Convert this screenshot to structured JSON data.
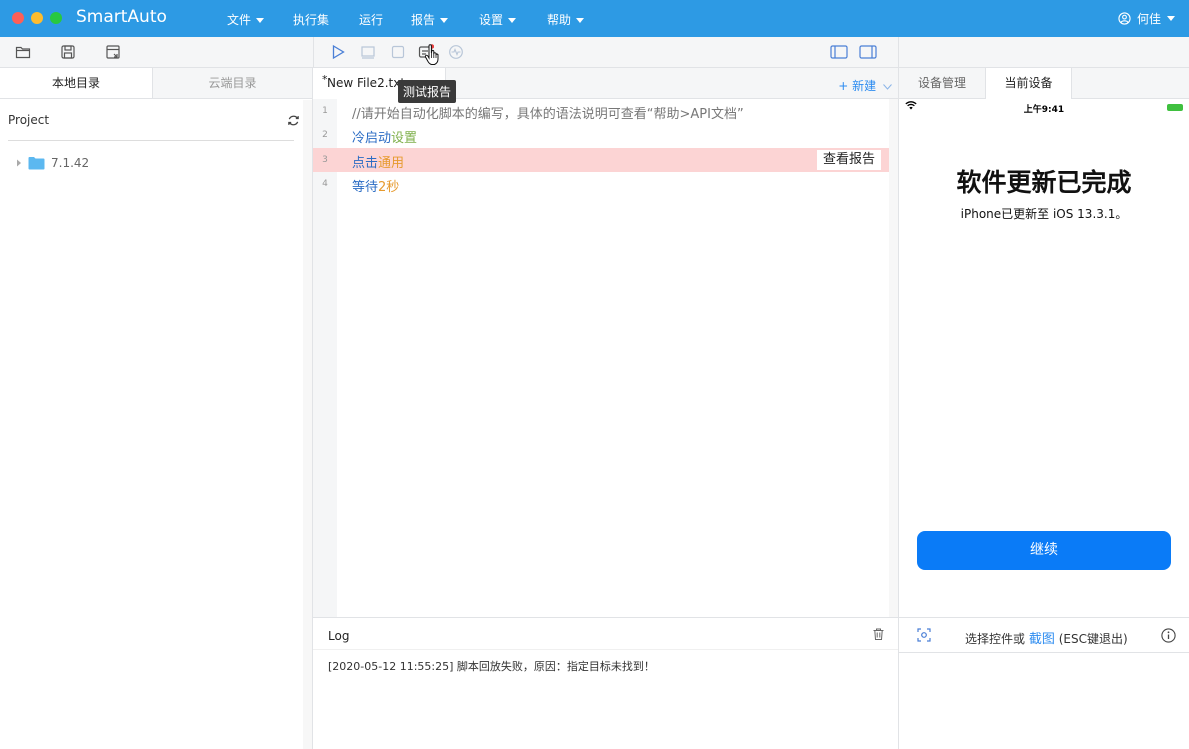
{
  "app": {
    "name": "SmartAuto"
  },
  "menu": {
    "file": "文件",
    "suite": "执行集",
    "run": "运行",
    "report": "报告",
    "settings": "设置",
    "help": "帮助"
  },
  "user": {
    "name": "何佳"
  },
  "left_panel": {
    "tabs": [
      "本地目录",
      "云端目录"
    ],
    "project_label": "Project",
    "folder": "7.1.42"
  },
  "editor": {
    "tab_title": "New File2.txt",
    "modified_marker": "*",
    "new_label": "+ 新建",
    "tooltip": "测试报告",
    "lines": [
      {
        "num": "1",
        "comment": "//请开始自动化脚本的编写，具体的语法说明可查看“帮助>API文档”"
      },
      {
        "num": "2",
        "keyword": "冷启动",
        "arg": "设置"
      },
      {
        "num": "3",
        "keyword": "点击",
        "arg": "通用",
        "action": "查看报告"
      },
      {
        "num": "4",
        "keyword": "等待",
        "arg": "2秒"
      }
    ]
  },
  "log": {
    "title": "Log",
    "entries": [
      "[2020-05-12 11:55:25] 脚本回放失败，原因：指定目标未找到！"
    ]
  },
  "right_panel": {
    "tabs": [
      "设备管理",
      "当前设备"
    ],
    "status_time": "上午9:41",
    "update_title": "软件更新已完成",
    "update_subtitle": "iPhone已更新至 iOS 13.3.1。",
    "continue": "继续",
    "select_text": "选择控件或",
    "screenshot_link": "截图",
    "esc_hint": "(ESC键退出)"
  },
  "colors": {
    "titlebar": "#2d9ae4",
    "accent": "#2d8cf0",
    "error_line": "#fcd4d4",
    "continue_button": "#0a7bf7"
  }
}
